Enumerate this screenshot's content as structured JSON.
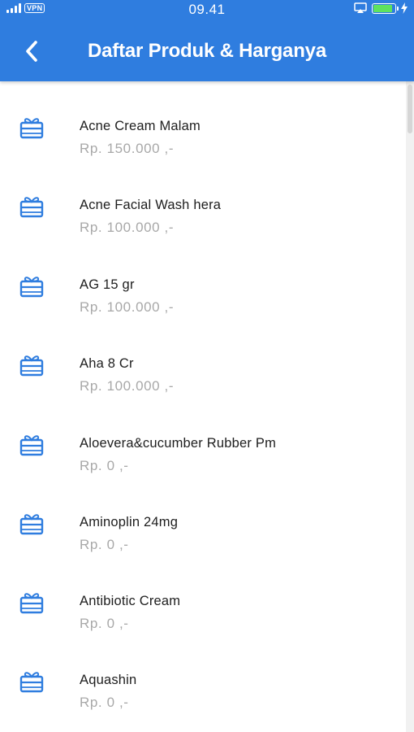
{
  "status_bar": {
    "vpn": "VPN",
    "time": "09.41"
  },
  "header": {
    "title": "Daftar Produk & Harganya"
  },
  "products": [
    {
      "name": "Acne Cream Malam",
      "price": "Rp. 150.000 ,-"
    },
    {
      "name": "Acne Facial Wash hera",
      "price": "Rp. 100.000 ,-"
    },
    {
      "name": "AG 15 gr",
      "price": "Rp. 100.000 ,-"
    },
    {
      "name": "Aha 8 Cr",
      "price": "Rp. 100.000 ,-"
    },
    {
      "name": "Aloevera&cucumber Rubber Pm",
      "price": "Rp. 0 ,-"
    },
    {
      "name": "Aminoplin 24mg",
      "price": "Rp. 0 ,-"
    },
    {
      "name": "Antibiotic Cream",
      "price": "Rp. 0 ,-"
    },
    {
      "name": "Aquashin",
      "price": "Rp. 0 ,-"
    }
  ],
  "icons": {
    "back": "chevron-left-icon",
    "product": "gift-box-icon"
  },
  "colors": {
    "app_bar": "#2f7ddf",
    "icon": "#2f7ddf",
    "price_text": "#a8a8a8",
    "battery": "#5ee25e"
  }
}
